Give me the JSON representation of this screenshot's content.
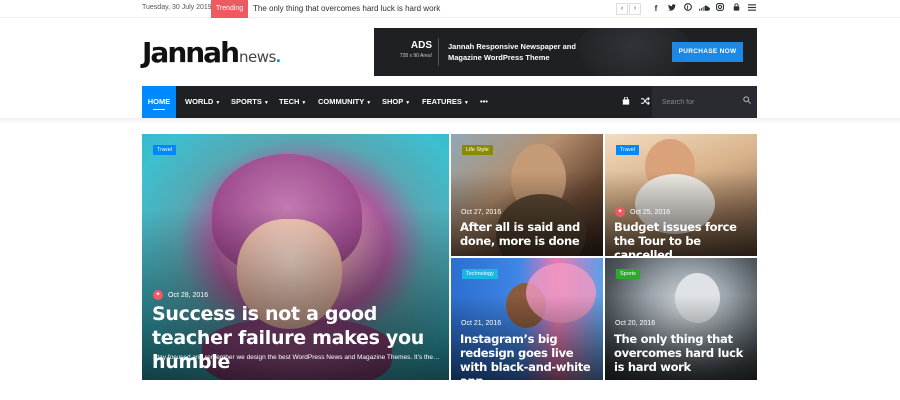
{
  "topbar": {
    "date": "Tuesday, 30 July 2019",
    "trending_label": "Trending",
    "ticker_text": "The only thing that overcomes hard luck is hard work",
    "prev_arrow": "‹",
    "next_arrow": "›",
    "social_icons": [
      "facebook-icon",
      "twitter-icon",
      "pinterest-icon",
      "soundcloud-icon",
      "instagram-icon",
      "lock-icon",
      "menu-icon"
    ]
  },
  "header": {
    "logo_main": "Jannah",
    "logo_sub": "news",
    "logo_dot": ".",
    "ad": {
      "ads_label": "ADS",
      "ads_size": "728 x 90 Area!",
      "text": "Jannah Responsive Newspaper and Magazine WordPress Theme",
      "button_label": "PURCHASE NOW"
    }
  },
  "nav": {
    "items": [
      {
        "label": "HOME",
        "active": true
      },
      {
        "label": "WORLD",
        "dropdown": true
      },
      {
        "label": "SPORTS",
        "dropdown": true
      },
      {
        "label": "TECH",
        "dropdown": true
      },
      {
        "label": "COMMUNITY",
        "dropdown": true
      },
      {
        "label": "SHOP",
        "dropdown": true
      },
      {
        "label": "FEATURES",
        "dropdown": true
      }
    ],
    "more": "•••",
    "search_placeholder": "Search for",
    "accent_color": "#0088ff"
  },
  "featured": {
    "main": {
      "category": "Travel",
      "category_color": "#0088ff",
      "date": "Oct 28, 2016",
      "title": "Success is not a good teacher failure makes you humble",
      "excerpt": "Stay focused and remember we design the best WordPress News and Magazine Themes. It’s the…"
    },
    "posts": [
      {
        "category": "Life Style",
        "category_color": "#8a8a00",
        "date": "Oct 27, 2016",
        "title": "After all is said and done, more is done",
        "trending": false
      },
      {
        "category": "Travel",
        "category_color": "#0088ff",
        "date": "Oct 25, 2016",
        "title": "Budget issues force the Tour to be cancelled",
        "trending": true
      },
      {
        "category": "Technology",
        "category_color": "#1ab7e4",
        "date": "Oct 21, 2016",
        "title": "Instagram’s big redesign goes live with black-and-white app",
        "trending": false
      },
      {
        "category": "Sports",
        "category_color": "#2ea82e",
        "date": "Oct 20, 2016",
        "title": "The only thing that overcomes hard luck is hard work",
        "trending": false
      }
    ]
  }
}
